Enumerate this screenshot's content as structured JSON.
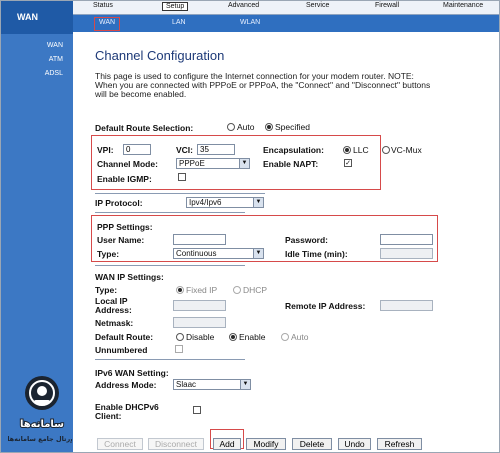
{
  "brand": "WAN",
  "sidebar": {
    "items": [
      "WAN",
      "ATM",
      "ADSL"
    ]
  },
  "top_tabs": [
    "Status",
    "Setup",
    "Advanced",
    "Service",
    "Firewall",
    "Maintenance"
  ],
  "sub_tabs": [
    "WAN",
    "LAN",
    "WLAN"
  ],
  "page": {
    "title": "Channel Configuration",
    "description": "This page is used to configure the Internet connection for your modem router. NOTE: When you are connected with PPPoE or PPPoA, the \"Connect\" and \"Disconnect\" buttons will be become enabled."
  },
  "default_route": {
    "label": "Default Route Selection:",
    "options": [
      "Auto",
      "Specified"
    ],
    "selected": "Specified"
  },
  "channel": {
    "vpi_label": "VPI:",
    "vpi": "0",
    "vci_label": "VCI:",
    "vci": "35",
    "encap_label": "Encapsulation:",
    "encap_options": [
      "LLC",
      "VC-Mux"
    ],
    "encap_selected": "LLC",
    "mode_label": "Channel Mode:",
    "mode": "PPPoE",
    "napt_label": "Enable NAPT:",
    "napt": "✓",
    "igmp_label": "Enable IGMP:"
  },
  "ip_protocol": {
    "label": "IP Protocol:",
    "value": "Ipv4/Ipv6"
  },
  "ppp": {
    "heading": "PPP Settings:",
    "user_label": "User Name:",
    "user": "",
    "pass_label": "Password:",
    "pass": "",
    "type_label": "Type:",
    "type": "Continuous",
    "idle_label": "Idle Time (min):",
    "idle": ""
  },
  "wan_ip": {
    "heading": "WAN IP Settings:",
    "type_label": "Type:",
    "type_options": [
      "Fixed IP",
      "DHCP"
    ],
    "local_label": "Local IP Address:",
    "remote_label": "Remote IP Address:",
    "netmask_label": "Netmask:",
    "route_label": "Default Route:",
    "route_options": [
      "Disable",
      "Enable",
      "Auto"
    ],
    "route_selected": "Enable",
    "unnumbered_label": "Unnumbered"
  },
  "ipv6": {
    "heading": "IPv6 WAN Setting:",
    "mode_label": "Address Mode:",
    "mode": "Slaac",
    "dhcp_label": "Enable DHCPv6 Client:"
  },
  "buttons": [
    "Connect",
    "Disconnect",
    "Add",
    "Modify",
    "Delete",
    "Undo",
    "Refresh"
  ],
  "watermark": {
    "line1": "سامانه‌ها",
    "line2": "پورتال جامع سامانه‌ها"
  }
}
